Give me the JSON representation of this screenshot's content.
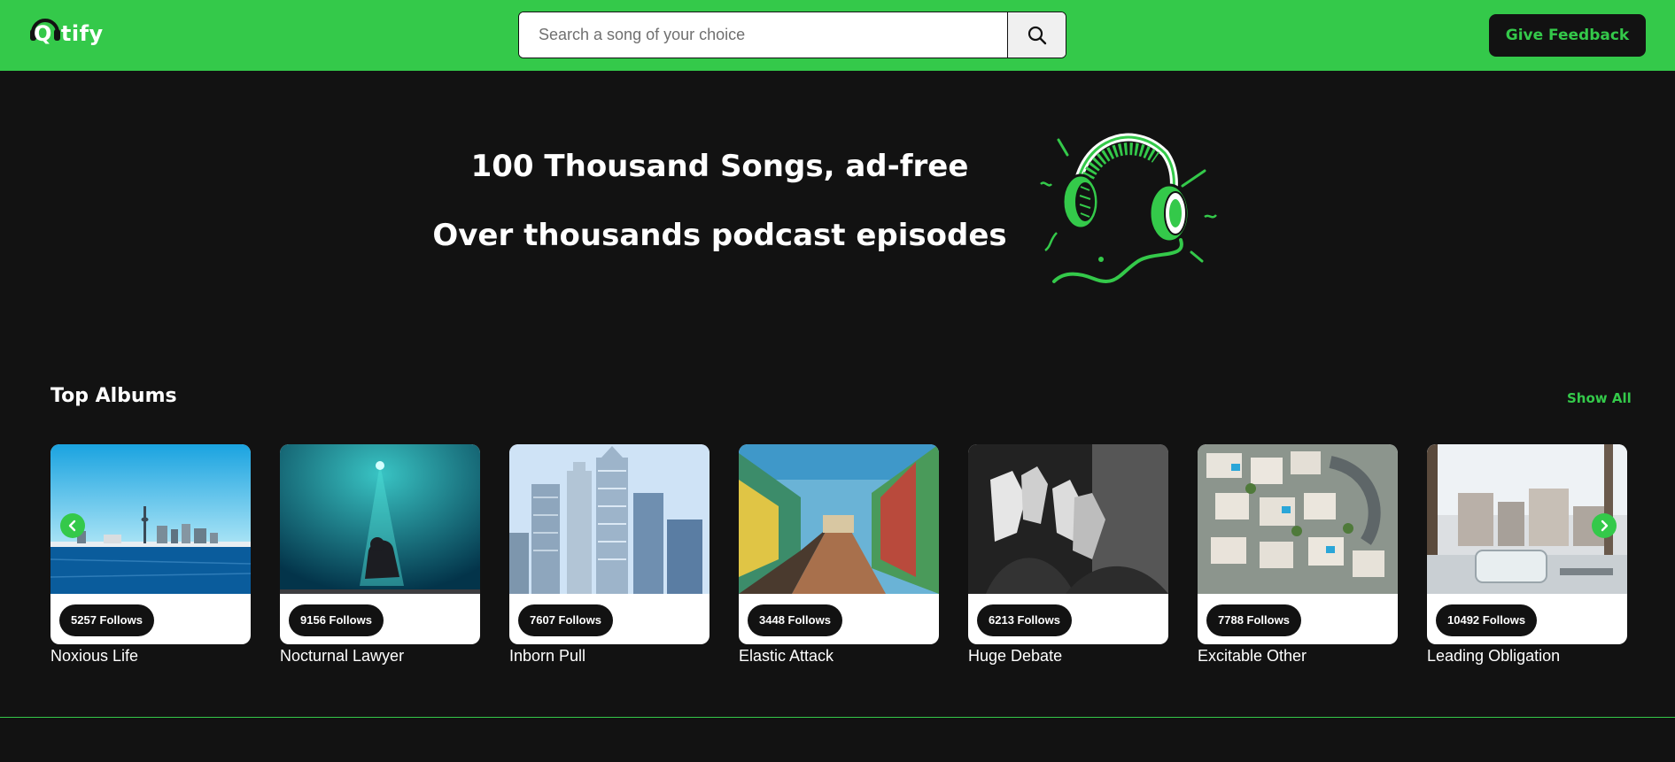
{
  "header": {
    "logo": {
      "icon": "headphones-icon",
      "letter": "Q",
      "text": "tify"
    },
    "search": {
      "placeholder": "Search a song of your choice",
      "value": "",
      "button_icon": "search-icon"
    },
    "feedback_label": "Give Feedback"
  },
  "hero": {
    "line1": "100 Thousand Songs, ad-free",
    "line2": "Over thousands podcast episodes",
    "illustration": "headphones-illustration"
  },
  "top_albums": {
    "title": "Top Albums",
    "show_all_label": "Show All",
    "prev_icon": "chevron-left-icon",
    "next_icon": "chevron-right-icon",
    "albums": [
      {
        "follows": "5257 Follows",
        "title": "Noxious Life",
        "image": "city-skyline-over-water"
      },
      {
        "follows": "9156 Follows",
        "title": "Nocturnal Lawyer",
        "image": "figure-under-spotlight"
      },
      {
        "follows": "7607 Follows",
        "title": "Inborn Pull",
        "image": "skyscrapers"
      },
      {
        "follows": "3448 Follows",
        "title": "Elastic Attack",
        "image": "colorful-street"
      },
      {
        "follows": "6213 Follows",
        "title": "Huge Debate",
        "image": "raised-hands-bw"
      },
      {
        "follows": "7788 Follows",
        "title": "Excitable Other",
        "image": "aerial-houses"
      },
      {
        "follows": "10492 Follows",
        "title": "Leading Obligation",
        "image": "window-city-view"
      }
    ]
  },
  "colors": {
    "brand": "#34c94a",
    "background": "#121212",
    "card": "#ffffff"
  }
}
